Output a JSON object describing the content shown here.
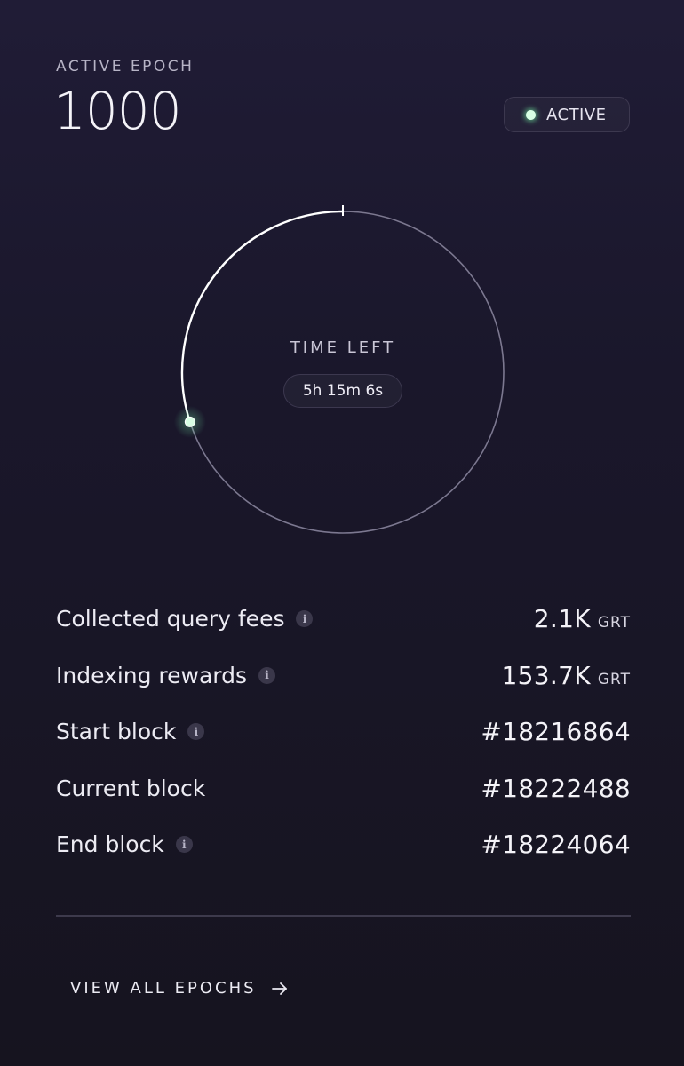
{
  "header": {
    "eyebrow": "ACTIVE EPOCH",
    "epoch_number": "1000",
    "status": {
      "label": "ACTIVE",
      "dot_color": "#d8ffe4"
    }
  },
  "timer": {
    "label": "TIME LEFT",
    "remaining": "5h 15m 6s",
    "progress_fraction": 0.3,
    "arc_color": "#ffffff",
    "track_color": "#7c7890",
    "marker_color": "#d8ffe4"
  },
  "stats": [
    {
      "label": "Collected query fees",
      "has_info": true,
      "value": "2.1K",
      "unit": "GRT"
    },
    {
      "label": "Indexing rewards",
      "has_info": true,
      "value": "153.7K",
      "unit": "GRT"
    },
    {
      "label": "Start block",
      "has_info": true,
      "value": "#18216864",
      "unit": ""
    },
    {
      "label": "Current block",
      "has_info": false,
      "value": "#18222488",
      "unit": ""
    },
    {
      "label": "End block",
      "has_info": true,
      "value": "#18224064",
      "unit": ""
    }
  ],
  "footer": {
    "view_all_label": "VIEW ALL EPOCHS",
    "arrow_icon": "arrow-right-icon"
  },
  "icons": {
    "info": "i"
  }
}
